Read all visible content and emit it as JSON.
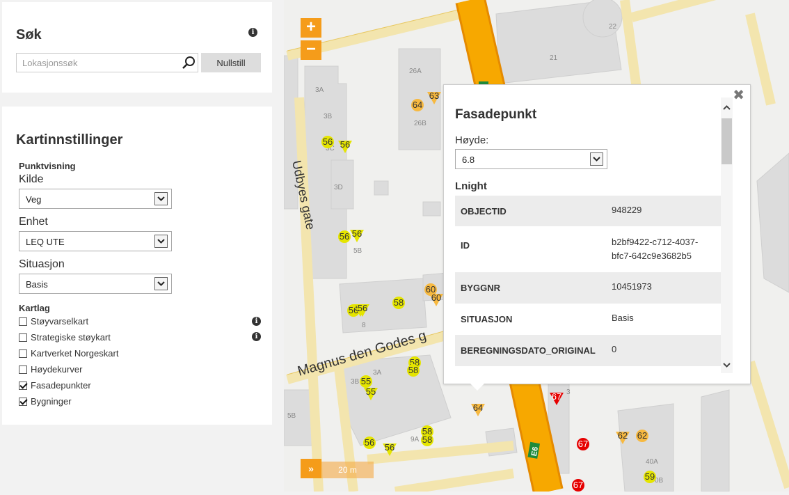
{
  "search": {
    "title": "Søk",
    "placeholder": "Lokasjonssøk",
    "reset_label": "Nullstill"
  },
  "settings": {
    "title": "Kartinnstillinger",
    "punktvisning_label": "Punktvisning",
    "kilde_label": "Kilde",
    "kilde_value": "Veg",
    "enhet_label": "Enhet",
    "enhet_value": "LEQ UTE",
    "situasjon_label": "Situasjon",
    "situasjon_value": "Basis",
    "kartlag_label": "Kartlag",
    "layers": [
      {
        "label": "Støyvarselkart",
        "checked": false,
        "info": true
      },
      {
        "label": "Strategiske støykart",
        "checked": false,
        "info": true
      },
      {
        "label": "Kartverket Norgeskart",
        "checked": false,
        "info": false
      },
      {
        "label": "Høydekurver",
        "checked": false,
        "info": false
      },
      {
        "label": "Fasadepunkter",
        "checked": true,
        "info": false
      },
      {
        "label": "Bygninger",
        "checked": true,
        "info": false
      }
    ]
  },
  "map": {
    "zoom_in": "+",
    "zoom_out": "−",
    "scale_label": "20 m",
    "expand_label": "»",
    "street_labels": [
      "Udbyes gate",
      "Magnus den Godes g",
      "E6"
    ],
    "address_labels": [
      "3A",
      "3B",
      "3C",
      "3D",
      "5B",
      "8",
      "26A",
      "26B",
      "21",
      "22",
      "3A",
      "3B",
      "5B",
      "9A",
      "40A",
      "0B",
      "3"
    ],
    "markers": [
      "56",
      "56",
      "56",
      "56",
      "56",
      "56",
      "56",
      "58",
      "60",
      "60",
      "63",
      "64",
      "58",
      "58",
      "55",
      "55",
      "56",
      "56",
      "58",
      "58",
      "64",
      "67",
      "67",
      "67",
      "62",
      "62",
      "59"
    ]
  },
  "popup": {
    "title": "Fasadepunkt",
    "hoyde_label": "Høyde:",
    "hoyde_value": "6.8",
    "layer_name": "Lnight",
    "rows": [
      {
        "key": "OBJECTID",
        "value": "948229"
      },
      {
        "key": "ID",
        "value": "b2bf9422-c712-4037-bfc7-642c9e3682b5"
      },
      {
        "key": "BYGGNR",
        "value": "10451973"
      },
      {
        "key": "SITUASJON",
        "value": "Basis"
      },
      {
        "key": "BEREGNINGSDATO_ORIGINAL",
        "value": "0"
      }
    ],
    "close_label": "✖"
  },
  "colors": {
    "accent": "#f59c1a",
    "marker_yellow": "#e5e500",
    "marker_orange": "#f7b940",
    "marker_red": "#e60000",
    "road_main": "#f7a800"
  }
}
